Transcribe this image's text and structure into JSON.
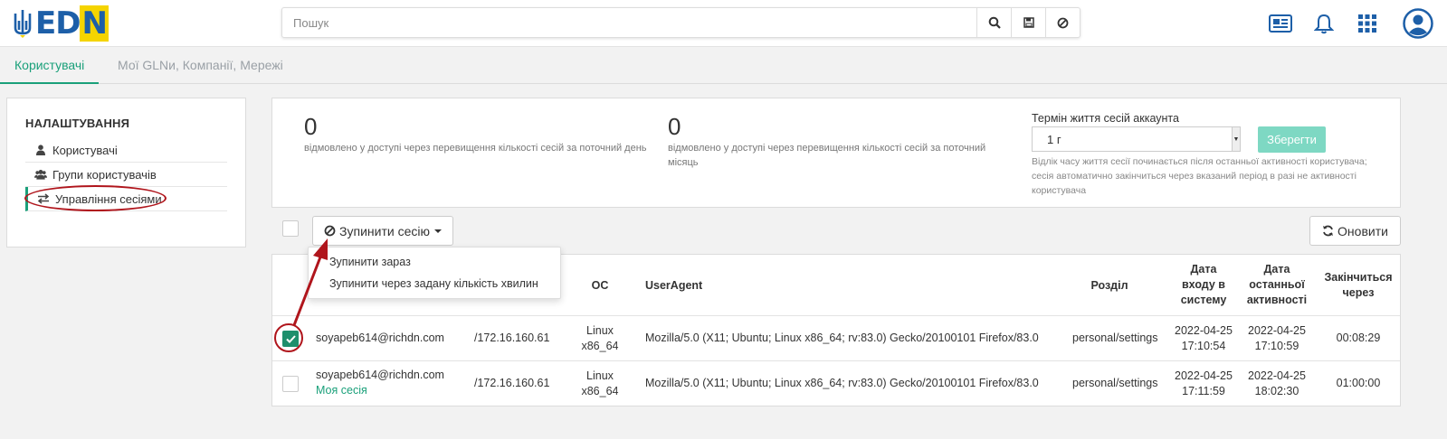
{
  "header": {
    "logo_text_ed": "ED",
    "logo_text_n": "N",
    "search_placeholder": "Пошук",
    "icons": [
      "search-icon",
      "save-icon",
      "ban-icon",
      "newspaper-icon",
      "bell-icon",
      "grid-icon",
      "user-avatar-icon"
    ]
  },
  "tabs": [
    {
      "label": "Користувачі",
      "active": true
    },
    {
      "label": "Мої GLNи, Компанії, Мережі",
      "active": false
    }
  ],
  "settings": {
    "title": "НАЛАШТУВАННЯ",
    "items": [
      {
        "label": "Користувачі",
        "icon": "user-icon"
      },
      {
        "label": "Групи користувачів",
        "icon": "users-icon"
      },
      {
        "label": "Управління сесіями",
        "icon": "exchange-icon",
        "selected": true
      }
    ]
  },
  "stats": {
    "day_count": "0",
    "day_desc": "відмовлено у доступі через перевищення кількості сесій за поточний день",
    "month_count": "0",
    "month_desc_1": "відмовлено у доступі через перевищення кількості сесій за поточний",
    "month_desc_2": "місяць",
    "ttl_label": "Термін життя сесій аккаунта",
    "ttl_value": "1 г",
    "save_label": "Зберегти",
    "ttl_help_1": "Відлік часу життя сесії починається після останньої активності користувача;",
    "ttl_help_2": "сесія автоматично закінчиться через вказаний період в разі не активності",
    "ttl_help_3": "користувача"
  },
  "actions": {
    "stop_label": "Зупинити сесію",
    "refresh_label": "Оновити",
    "dropdown": [
      "Зупинити зараз",
      "Зупинити через задану кількість хвилин"
    ]
  },
  "table": {
    "headers": {
      "os": "ОС",
      "useragent": "UserAgent",
      "section": "Розділ",
      "login_1": "Дата",
      "login_2": "входу в",
      "login_3": "систему",
      "last_1": "Дата",
      "last_2": "останньої",
      "last_3": "активності",
      "ends_1": "Закінчиться",
      "ends_2": "через"
    },
    "rows": [
      {
        "checked": true,
        "email": "soyapeb614@richdn.com",
        "my_session": "",
        "ip": "/172.16.160.61",
        "os_1": "Linux",
        "os_2": "x86_64",
        "useragent": "Mozilla/5.0 (X11; Ubuntu; Linux x86_64; rv:83.0) Gecko/20100101 Firefox/83.0",
        "section": "personal/settings",
        "login_date": "2022-04-25",
        "login_time": "17:10:54",
        "last_date": "2022-04-25",
        "last_time": "17:10:59",
        "ends": "00:08:29"
      },
      {
        "checked": false,
        "email": "soyapeb614@richdn.com",
        "my_session": "Моя сесія",
        "ip": "/172.16.160.61",
        "os_1": "Linux",
        "os_2": "x86_64",
        "useragent": "Mozilla/5.0 (X11; Ubuntu; Linux x86_64; rv:83.0) Gecko/20100101 Firefox/83.0",
        "section": "personal/settings",
        "login_date": "2022-04-25",
        "login_time": "17:11:59",
        "last_date": "2022-04-25",
        "last_time": "18:02:30",
        "ends": "01:00:00"
      }
    ]
  },
  "colors": {
    "accent": "#1aa07a",
    "annotation": "#b0151c",
    "brand_blue": "#1d5fa8",
    "brand_yellow": "#f5d400"
  }
}
